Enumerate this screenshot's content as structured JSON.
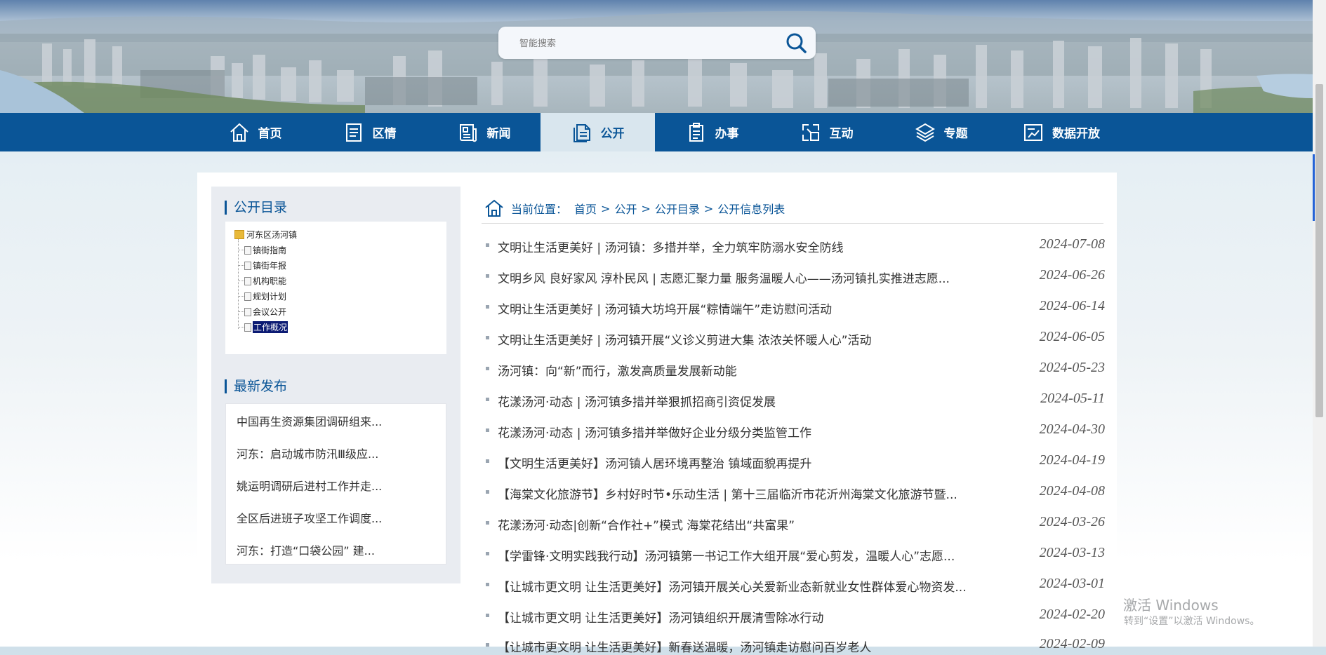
{
  "search": {
    "placeholder": "智能搜索"
  },
  "nav": {
    "items": [
      {
        "label": "首页",
        "icon": "home-icon"
      },
      {
        "label": "区情",
        "icon": "document-icon"
      },
      {
        "label": "新闻",
        "icon": "news-icon"
      },
      {
        "label": "公开",
        "icon": "file-icon",
        "active": true
      },
      {
        "label": "办事",
        "icon": "clipboard-icon"
      },
      {
        "label": "互动",
        "icon": "interact-icon"
      },
      {
        "label": "专题",
        "icon": "layers-icon"
      },
      {
        "label": "数据开放",
        "icon": "chart-icon"
      }
    ]
  },
  "sidebar": {
    "catalog_title": "公开目录",
    "tree_root": "河东区汤河镇",
    "tree_items": [
      "镇街指南",
      "镇街年报",
      "机构职能",
      "规划计划",
      "会议公开",
      "工作概况"
    ],
    "selected_item": "工作概况",
    "latest_title": "最新发布",
    "latest_items": [
      "中国再生资源集团调研组来...",
      "河东：启动城市防汛Ⅲ级应...",
      "姚运明调研后进村工作并走...",
      "全区后进班子攻坚工作调度...",
      "河东：打造“口袋公园” 建..."
    ]
  },
  "breadcrumb": {
    "prefix": "当前位置：",
    "links": [
      "首页",
      "公开",
      "公开目录",
      "公开信息列表"
    ],
    "separator": ">"
  },
  "articles": [
    {
      "title": "文明让生活更美好 | 汤河镇：多措并举，全力筑牢防溺水安全防线",
      "date": "2024-07-08"
    },
    {
      "title": "文明乡风 良好家风 淳朴民风 | 志愿汇聚力量 服务温暖人心——汤河镇扎实推进志愿...",
      "date": "2024-06-26"
    },
    {
      "title": "文明让生活更美好 | 汤河镇大坊坞开展“粽情端午”走访慰问活动",
      "date": "2024-06-14"
    },
    {
      "title": "文明让生活更美好 | 汤河镇开展“义诊义剪进大集 浓浓关怀暖人心”活动",
      "date": "2024-06-05"
    },
    {
      "title": "汤河镇：向“新”而行，激发高质量发展新动能",
      "date": "2024-05-23"
    },
    {
      "title": "花漾汤河·动态 | 汤河镇多措并举狠抓招商引资促发展",
      "date": "2024-05-11"
    },
    {
      "title": "花漾汤河·动态 | 汤河镇多措并举做好企业分级分类监管工作",
      "date": "2024-04-30"
    },
    {
      "title": "【文明生活更美好】汤河镇人居环境再整治 镇域面貌再提升",
      "date": "2024-04-19"
    },
    {
      "title": "【海棠文化旅游节】乡村好时节•乐动生活 | 第十三届临沂市花沂州海棠文化旅游节暨...",
      "date": "2024-04-08"
    },
    {
      "title": "花漾汤河·动态|创新“合作社+”模式 海棠花结出“共富果”",
      "date": "2024-03-26"
    },
    {
      "title": "【学雷锋·文明实践我行动】汤河镇第一书记工作大组开展“爱心剪发，温暖人心”志愿...",
      "date": "2024-03-13"
    },
    {
      "title": "【让城市更文明 让生活更美好】汤河镇开展关心关爱新业态新就业女性群体爱心物资发...",
      "date": "2024-03-01"
    },
    {
      "title": "【让城市更文明 让生活更美好】汤河镇组织开展清雪除冰行动",
      "date": "2024-02-20"
    },
    {
      "title": "【让城市更文明 让生活更美好】新春送温暖，汤河镇走访慰问百岁老人",
      "date": "2024-02-09"
    }
  ],
  "watermark": {
    "line1": "激活 Windows",
    "line2": "转到“设置”以激活 Windows。"
  },
  "colors": {
    "nav_bg": "#0a5597",
    "nav_active_bg": "#d9e6ee",
    "accent": "#0a5597",
    "selected_tree_bg": "#0b1a73"
  }
}
